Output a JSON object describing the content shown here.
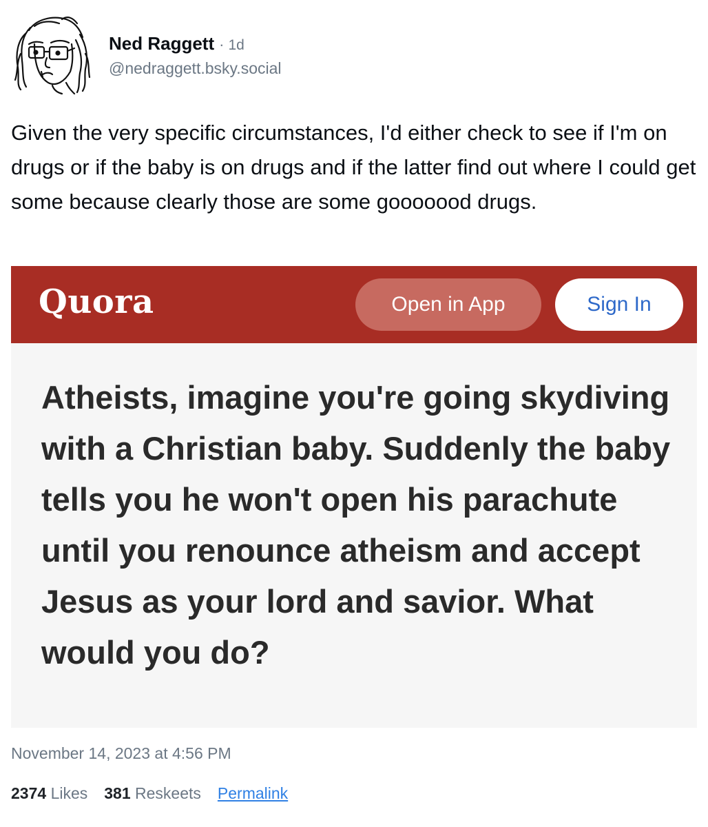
{
  "author": {
    "display_name": "Ned Raggett",
    "separator": "·",
    "time_ago": "1d",
    "handle": "@nedraggett.bsky.social",
    "avatar_icon": "sketch-portrait-avatar"
  },
  "post": {
    "text": "Given the very specific circumstances, I'd either check to see if I'm on drugs or if the baby is on drugs and if the latter find out where I could get some because clearly those are some gooooood drugs."
  },
  "embed": {
    "brand": "Quora",
    "brand_color": "#a82d24",
    "open_in_app_label": "Open in App",
    "sign_in_label": "Sign In",
    "question": "Atheists, imagine you're going skydiving with a Christian baby. Suddenly the baby tells you he won't open his parachute until you renounce atheism and accept Jesus as your lord and savior. What would you do?"
  },
  "meta": {
    "timestamp": "November 14, 2023 at 4:56 PM",
    "likes_count": "2374",
    "likes_label": "Likes",
    "reskeets_count": "381",
    "reskeets_label": "Reskeets",
    "permalink_label": "Permalink",
    "link_color": "#2f80e4"
  }
}
